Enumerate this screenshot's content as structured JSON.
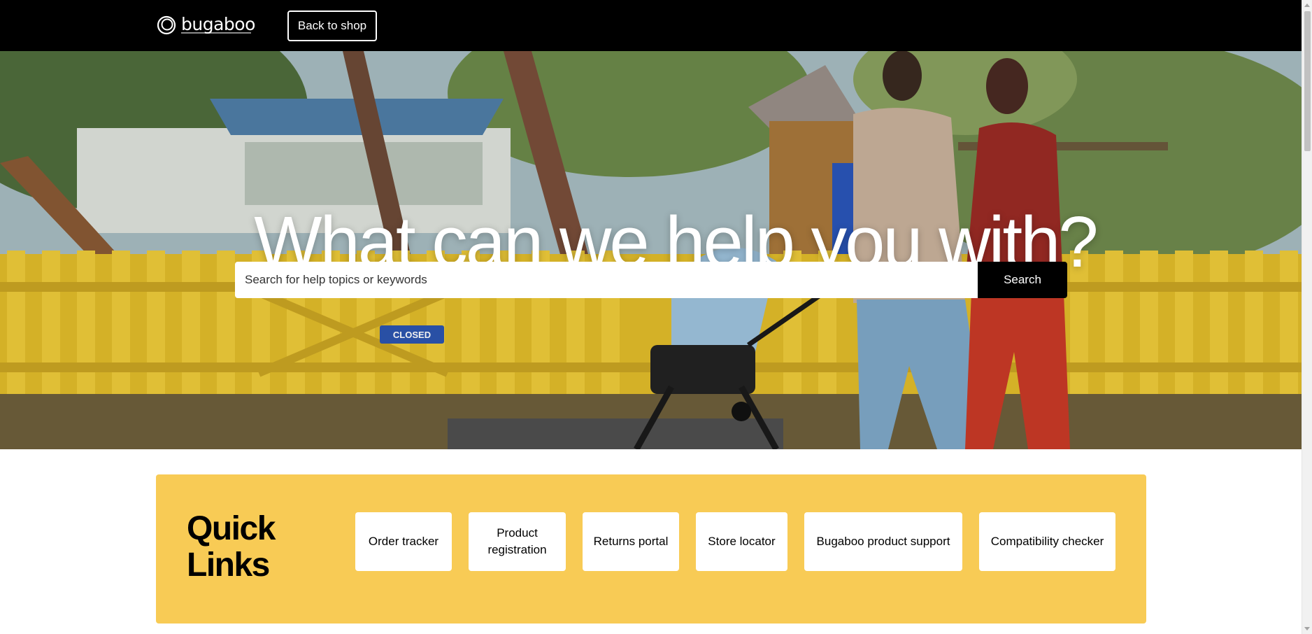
{
  "header": {
    "logo_text": "bugaboo",
    "back_to_shop_label": "Back to shop"
  },
  "hero": {
    "title": "What can we help you with?",
    "image_sign_text": "CLOSED",
    "search": {
      "placeholder": "Search for help topics or keywords",
      "value": "",
      "button_label": "Search"
    }
  },
  "quick_links": {
    "title": "Quick Links",
    "items": [
      {
        "label": "Order tracker"
      },
      {
        "label": "Product registration"
      },
      {
        "label": "Returns portal"
      },
      {
        "label": "Store locator"
      },
      {
        "label": "Bugaboo product support"
      },
      {
        "label": "Compatibility checker"
      }
    ]
  },
  "colors": {
    "header_bg": "#000000",
    "quick_links_bg": "#f8cb55",
    "search_button_bg": "#000000",
    "fence_yellow": "#e2bd2a"
  }
}
